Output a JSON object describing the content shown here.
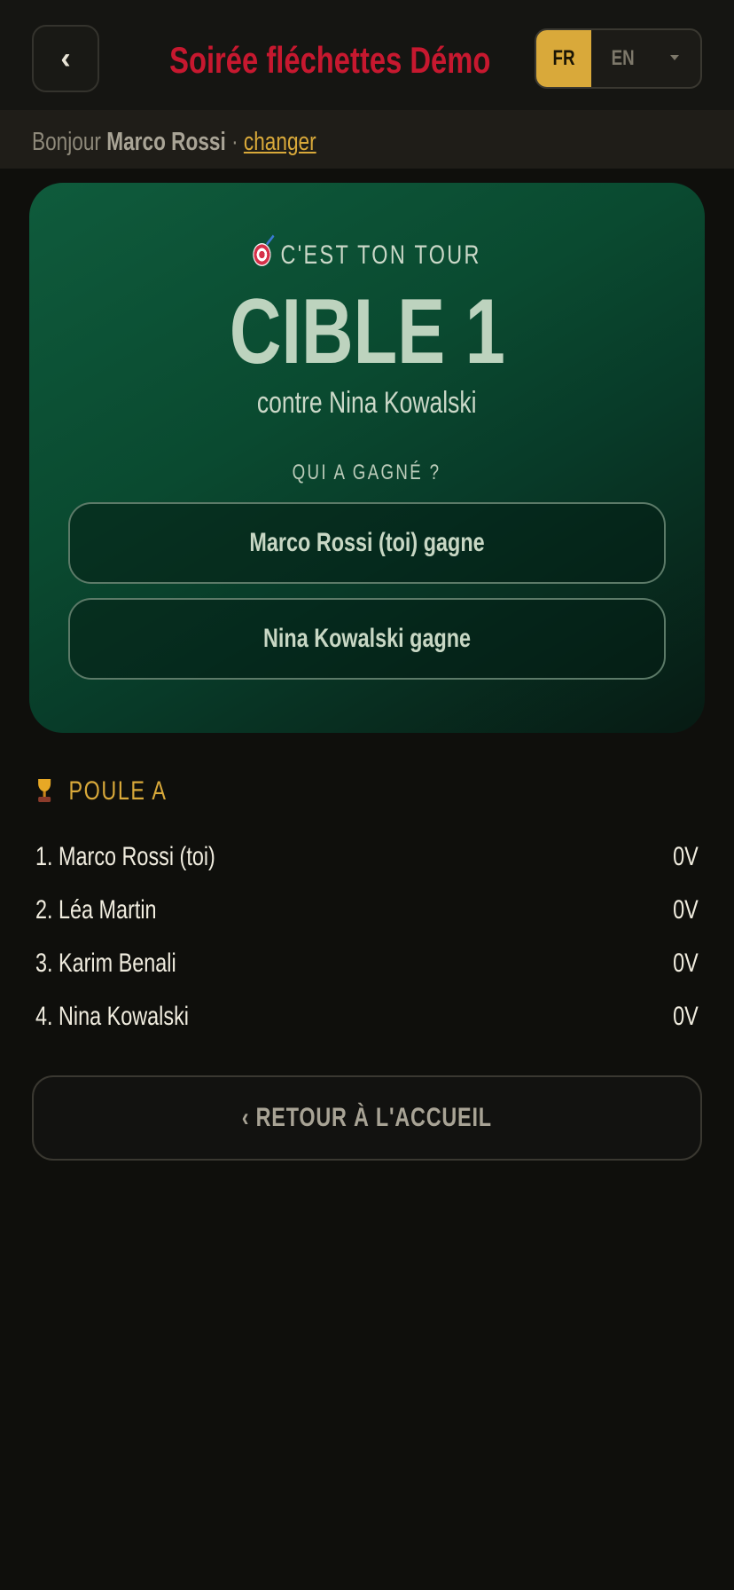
{
  "header": {
    "back_label": "‹",
    "title": "Soirée fléchettes Démo",
    "lang_fr": "FR",
    "lang_en": "EN"
  },
  "greeting": {
    "prefix": "Bonjour",
    "name": "Marco Rossi",
    "separator": "·",
    "change_label": "changer"
  },
  "turn": {
    "label": "C'EST TON TOUR",
    "target": "CIBLE 1",
    "opponent_text": "contre Nina Kowalski",
    "question": "QUI A GAGNÉ ?",
    "option_self": "Marco Rossi (toi) gagne",
    "option_opponent": "Nina Kowalski gagne"
  },
  "pool": {
    "title": "POULE A",
    "standings": [
      {
        "name": "1. Marco Rossi (toi)",
        "score": "0V"
      },
      {
        "name": "2. Léa Martin",
        "score": "0V"
      },
      {
        "name": "3. Karim Benali",
        "score": "0V"
      },
      {
        "name": "4. Nina Kowalski",
        "score": "0V"
      }
    ]
  },
  "footer": {
    "home_label": "‹ RETOUR À L'ACCUEIL"
  },
  "colors": {
    "accent_gold": "#d9a93a",
    "title_red": "#c7182f",
    "card_green": "#0a4a30",
    "background": "#0f0f0c"
  },
  "icons": [
    "chevron-left-icon",
    "target-icon",
    "trophy-icon",
    "caret-down-icon"
  ]
}
